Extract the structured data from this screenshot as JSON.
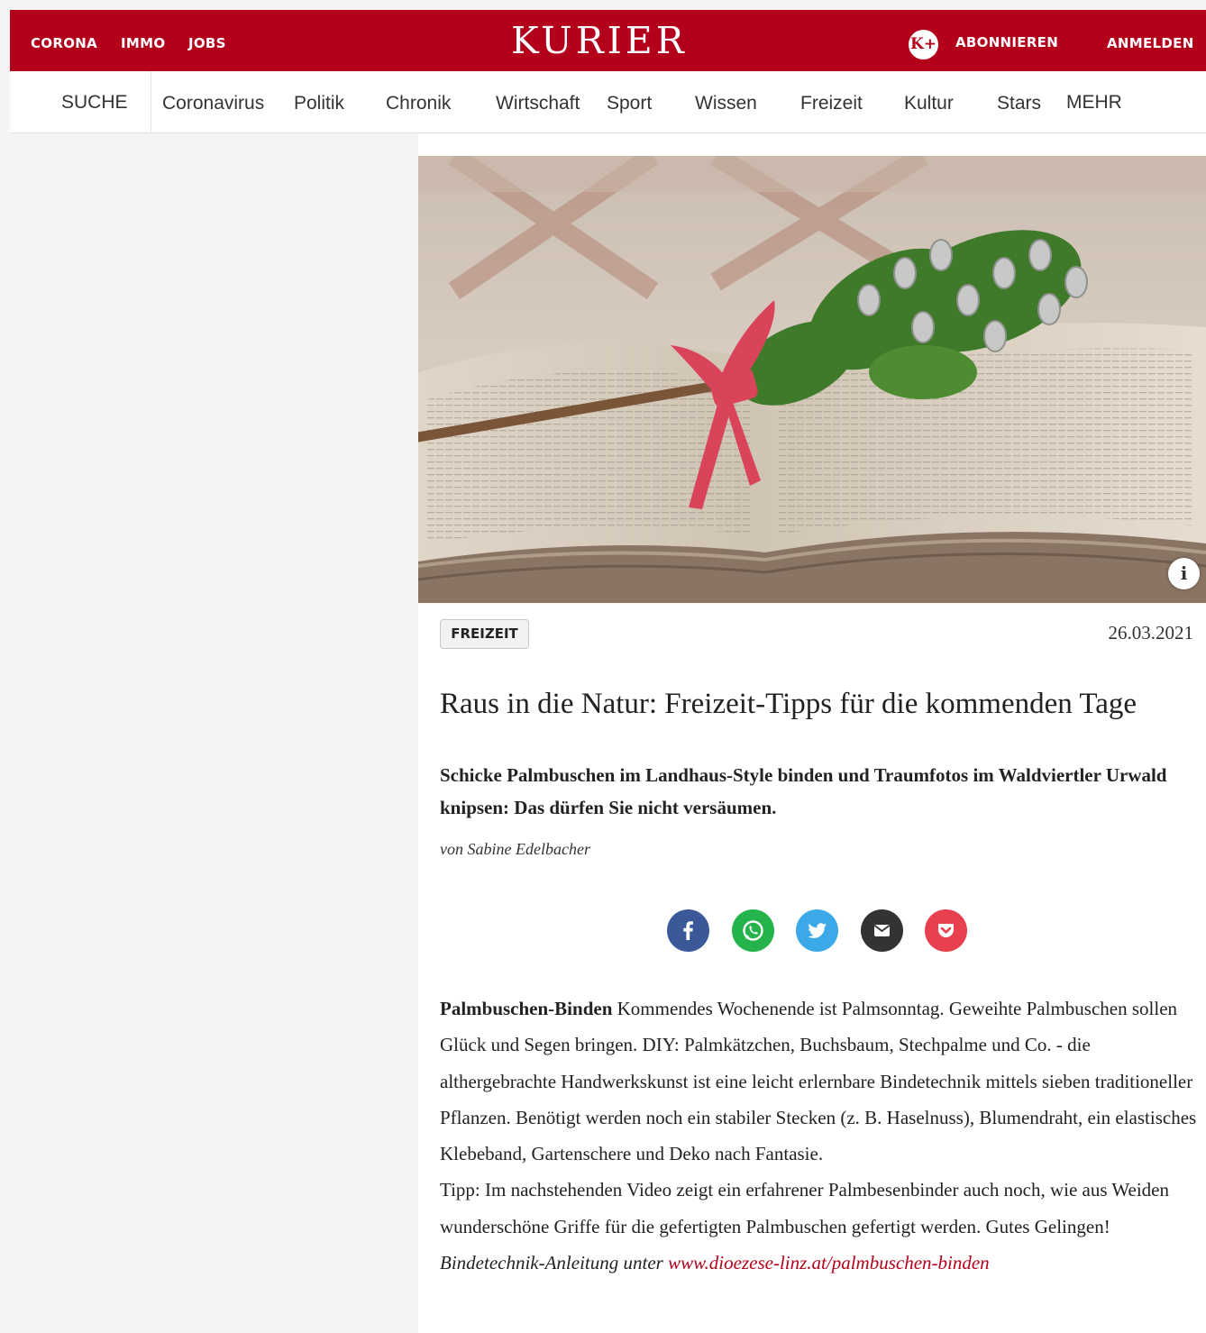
{
  "topbar": {
    "links": [
      "CORONA",
      "IMMO",
      "JOBS"
    ],
    "logo": "KURIER",
    "kplus_icon": "K+",
    "subscribe": "ABONNIEREN",
    "login": "ANMELDEN"
  },
  "nav": {
    "search": "SUCHE",
    "items": [
      "Coronavirus",
      "Politik",
      "Chronik",
      "Wirtschaft",
      "Sport",
      "Wissen",
      "Freizeit",
      "Kultur",
      "Stars"
    ],
    "more": "MEHR"
  },
  "article": {
    "image_info_icon": "info-icon",
    "category": "FREIZEIT",
    "date": "26.03.2021",
    "headline": "Raus in die Natur: Freizeit-Tipps für die kommenden Tage",
    "lead": "Schicke Palmbuschen im Landhaus-Style binden und Traumfotos im Waldviertler Urwald knipsen: Das dürfen Sie nicht versäumen.",
    "author": "von Sabine Edelbacher",
    "share": [
      {
        "name": "facebook-icon",
        "color": "#3b5998"
      },
      {
        "name": "whatsapp-icon",
        "color": "#25b34b"
      },
      {
        "name": "twitter-icon",
        "color": "#3ba9e8"
      },
      {
        "name": "email-icon",
        "color": "#333333"
      },
      {
        "name": "pocket-icon",
        "color": "#e8404f"
      }
    ],
    "body": {
      "intro_bold": "Palmbuschen-Binden",
      "paragraph1": " Kommendes Wochenende ist Palmsonntag. Geweihte Palmbuschen sollen Glück und Segen bringen. DIY: Palmkätzchen, Buchsbaum, Stechpalme und Co. - die althergebrachte Handwerkskunst ist eine leicht erlernbare Bindetechnik mittels sieben traditioneller Pflanzen. Benötigt werden noch ein stabiler Stecken (z. B. Haselnuss), Blumendraht, ein elastisches Klebeband, Gartenschere und Deko nach Fantasie.",
      "paragraph2": "Tipp: Im nachstehenden Video zeigt ein erfahrener Palmbesenbinder auch noch, wie aus Weiden wunderschöne Griffe für die gefertigten Palmbuschen gefertigt werden. Gutes Gelingen!",
      "link_prefix": "Bindetechnik-Anleitung unter ",
      "link_text": "www.dioezese-linz.at/palmbuschen-binden"
    }
  },
  "colors": {
    "brand_red": "#b3001b",
    "link_red": "#b3001b"
  }
}
